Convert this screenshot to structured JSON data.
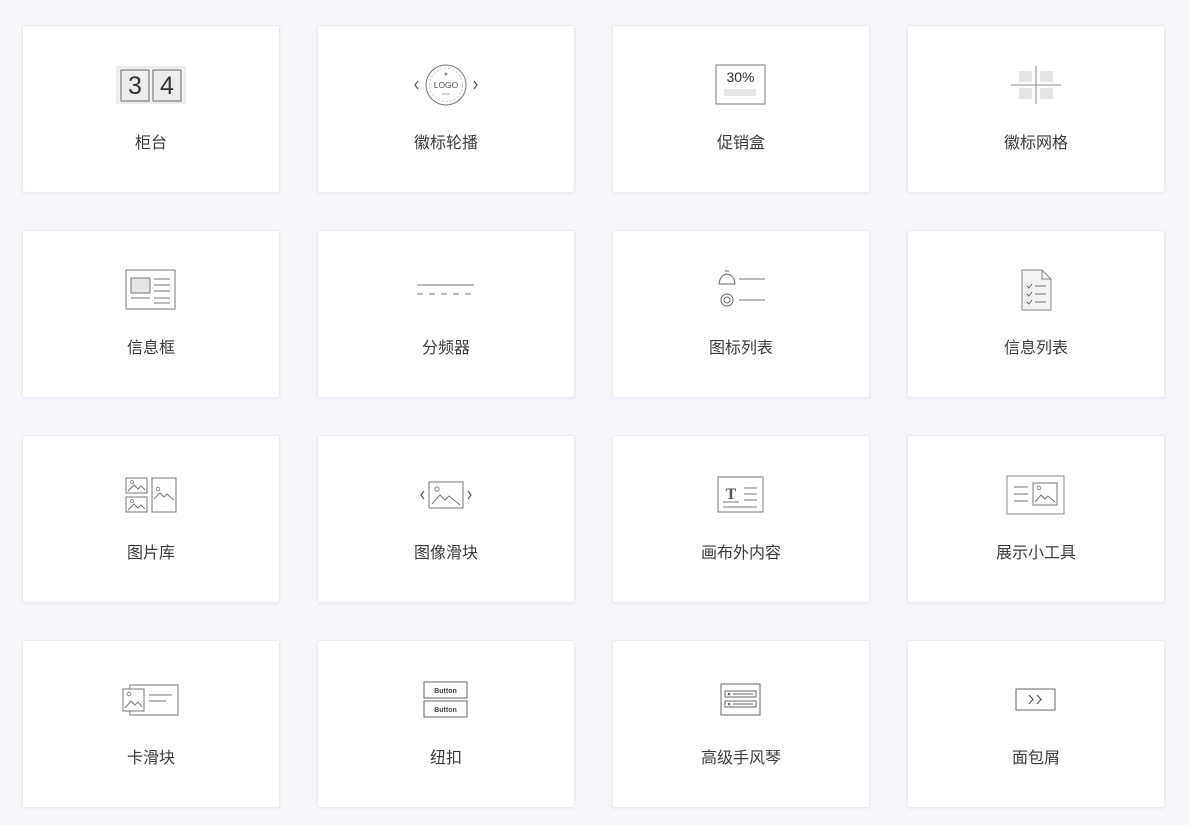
{
  "widgets": [
    {
      "label": "柜台",
      "icon": "counter-icon"
    },
    {
      "label": "徽标轮播",
      "icon": "logo-carousel-icon"
    },
    {
      "label": "促销盒",
      "icon": "promo-box-icon"
    },
    {
      "label": "徽标网格",
      "icon": "logo-grid-icon"
    },
    {
      "label": "信息框",
      "icon": "info-box-icon"
    },
    {
      "label": "分频器",
      "icon": "divider-icon"
    },
    {
      "label": "图标列表",
      "icon": "icon-list-icon"
    },
    {
      "label": "信息列表",
      "icon": "info-list-icon"
    },
    {
      "label": "图片库",
      "icon": "image-gallery-icon"
    },
    {
      "label": "图像滑块",
      "icon": "image-slider-icon"
    },
    {
      "label": "画布外内容",
      "icon": "off-canvas-icon"
    },
    {
      "label": "展示小工具",
      "icon": "showcase-icon"
    },
    {
      "label": "卡滑块",
      "icon": "card-slider-icon"
    },
    {
      "label": "纽扣",
      "icon": "button-icon"
    },
    {
      "label": "高级手风琴",
      "icon": "accordion-icon"
    },
    {
      "label": "面包屑",
      "icon": "breadcrumb-icon"
    }
  ],
  "icon_text": {
    "counter_left": "3",
    "counter_right": "4",
    "logo_text": "LOGO",
    "promo_percent": "30%",
    "button_top": "Button",
    "button_bottom": "Button"
  },
  "colors": {
    "background": "#f6f7fb",
    "card": "#ffffff",
    "border": "#e9ebf2",
    "label": "#3b3b3b",
    "icon_stroke": "#555555"
  }
}
